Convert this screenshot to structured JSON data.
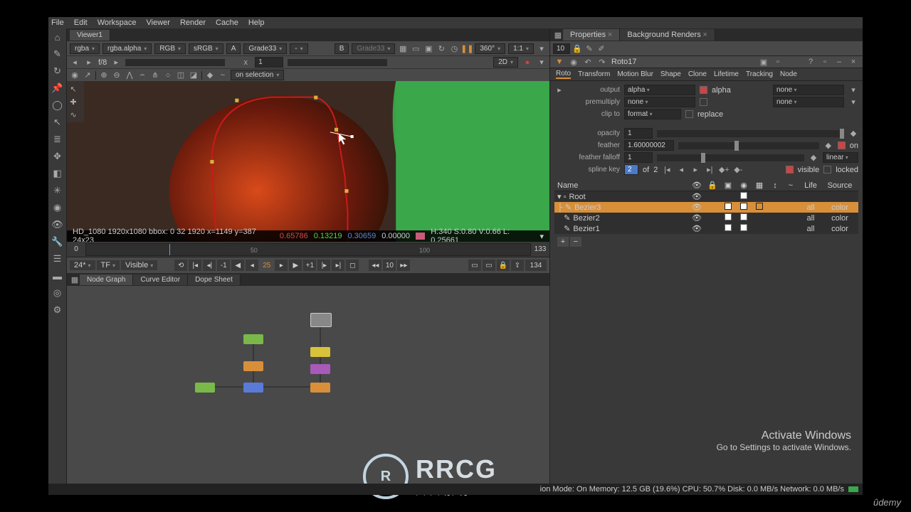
{
  "menu": [
    "File",
    "Edit",
    "Workspace",
    "Viewer",
    "Render",
    "Cache",
    "Help"
  ],
  "viewer_tab": "Viewer1",
  "toolbar": {
    "channels": "rgba",
    "layer": "rgba.alpha",
    "colorspace": "RGB",
    "view_lut": "sRGB",
    "input_a_label": "A",
    "input_a": "Grade33",
    "input_b_label": "B",
    "input_b": "Grade33",
    "zoom": "360°",
    "scale": "1:1"
  },
  "toolbar2": {
    "nav": [
      "◂",
      "▸",
      "f/8",
      "▸"
    ],
    "x_field": "1"
  },
  "toolbar3": {
    "selection_mode": "on selection"
  },
  "view_mode": "2D",
  "status": {
    "left": "HD_1080 1920x1080  bbox: 0 32 1920   x=1149 y=387 24x23",
    "r": "0.65786",
    "g": "0.13219",
    "b": "0.30659",
    "a": "0.00000",
    "right": "H:340 S:0.80 V:0.66  L: 0.25661"
  },
  "timeline": {
    "start": "0",
    "end": "133",
    "labels": [
      "50",
      "100"
    ],
    "current": "25",
    "fps": "24*",
    "tf": "TF",
    "visible": "Visible",
    "loop": "10",
    "total": "134"
  },
  "panels": [
    "Node Graph",
    "Curve Editor",
    "Dope Sheet"
  ],
  "right": {
    "prop_tab": "Properties",
    "bg_tab": "Background Renders",
    "count": "10",
    "node_name": "Roto17",
    "tabs": [
      "Roto",
      "Transform",
      "Motion Blur",
      "Shape",
      "Clone",
      "Lifetime",
      "Tracking",
      "Node"
    ],
    "output_label": "output",
    "output_value": "alpha",
    "output_math": "alpha",
    "output_math2": "none",
    "premult_label": "premultiply",
    "premult_value": "none",
    "premult_value2": "none",
    "clip_label": "clip to",
    "clip_value": "format",
    "replace": "replace",
    "opacity_label": "opacity",
    "opacity_value": "1",
    "feather_label": "feather",
    "feather_value": "1.60000002",
    "feather_on": "on",
    "falloff_label": "feather falloff",
    "falloff_value": "1",
    "falloff_type": "linear",
    "spline_label": "spline key",
    "spline_cur": "2",
    "spline_of": "of",
    "spline_total": "2",
    "vis": "visible",
    "lock": "locked",
    "list_hdr": {
      "name": "Name",
      "life": "Life",
      "src": "Source"
    },
    "rows": [
      {
        "name": "Root",
        "life": "",
        "src": ""
      },
      {
        "name": "Bezier3",
        "life": "all",
        "src": "color",
        "sel": true
      },
      {
        "name": "Bezier2",
        "life": "all",
        "src": "color"
      },
      {
        "name": "Bezier1",
        "life": "all",
        "src": "color"
      }
    ]
  },
  "watermark": {
    "t1": "Activate Windows",
    "t2": "Go to Settings to activate Windows."
  },
  "logo_text": "RRCG",
  "logo_sub": "人人素材",
  "bottom": "ion Mode: On Memory: 12.5 GB (19.6%) CPU: 50.7% Disk: 0.0 MB/s Network: 0.0 MB/s",
  "udemy": "ûdemy"
}
